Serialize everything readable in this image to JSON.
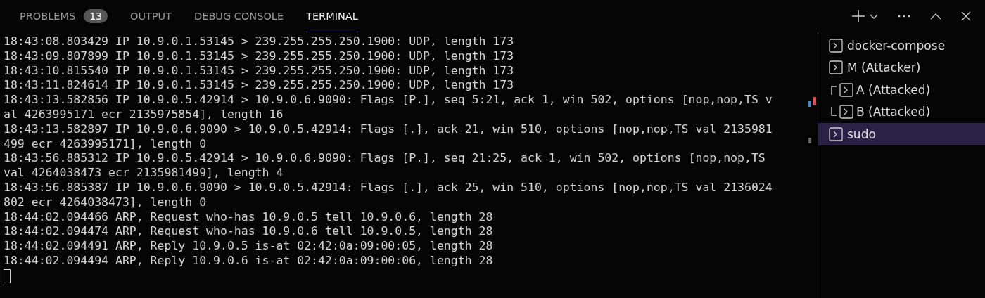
{
  "tabs": [
    {
      "label": "PROBLEMS",
      "badge": "13",
      "selected": false
    },
    {
      "label": "OUTPUT",
      "selected": false
    },
    {
      "label": "DEBUG CONSOLE",
      "selected": false
    },
    {
      "label": "TERMINAL",
      "selected": true
    }
  ],
  "terminal": {
    "lines": [
      "18:43:08.803429 IP 10.9.0.1.53145 > 239.255.255.250.1900: UDP, length 173",
      "18:43:09.807899 IP 10.9.0.1.53145 > 239.255.255.250.1900: UDP, length 173",
      "18:43:10.815540 IP 10.9.0.1.53145 > 239.255.255.250.1900: UDP, length 173",
      "18:43:11.824614 IP 10.9.0.1.53145 > 239.255.255.250.1900: UDP, length 173",
      "18:43:13.582856 IP 10.9.0.5.42914 > 10.9.0.6.9090: Flags [P.], seq 5:21, ack 1, win 502, options [nop,nop,TS v",
      "al 4263995171 ecr 2135975854], length 16",
      "18:43:13.582897 IP 10.9.0.6.9090 > 10.9.0.5.42914: Flags [.], ack 21, win 510, options [nop,nop,TS val 2135981",
      "499 ecr 4263995171], length 0",
      "18:43:56.885312 IP 10.9.0.5.42914 > 10.9.0.6.9090: Flags [P.], seq 21:25, ack 1, win 502, options [nop,nop,TS",
      "val 4264038473 ecr 2135981499], length 4",
      "18:43:56.885387 IP 10.9.0.6.9090 > 10.9.0.5.42914: Flags [.], ack 25, win 510, options [nop,nop,TS val 2136024",
      "802 ecr 4264038473], length 0",
      "18:44:02.094466 ARP, Request who-has 10.9.0.5 tell 10.9.0.6, length 28",
      "18:44:02.094474 ARP, Request who-has 10.9.0.6 tell 10.9.0.5, length 28",
      "18:44:02.094491 ARP, Reply 10.9.0.5 is-at 02:42:0a:09:00:05, length 28",
      "18:44:02.094494 ARP, Reply 10.9.0.6 is-at 02:42:0a:09:00:06, length 28"
    ]
  },
  "terminal_list": [
    {
      "kind": "terminal",
      "label": "docker-compose",
      "selected": false
    },
    {
      "kind": "terminal",
      "label": "M (Attacker)",
      "selected": false
    },
    {
      "kind": "group",
      "children": [
        {
          "label": "A (Attacked)",
          "selected": false
        },
        {
          "label": "B (Attacked)",
          "selected": false
        }
      ]
    },
    {
      "kind": "terminal",
      "label": "sudo",
      "selected": true
    }
  ]
}
